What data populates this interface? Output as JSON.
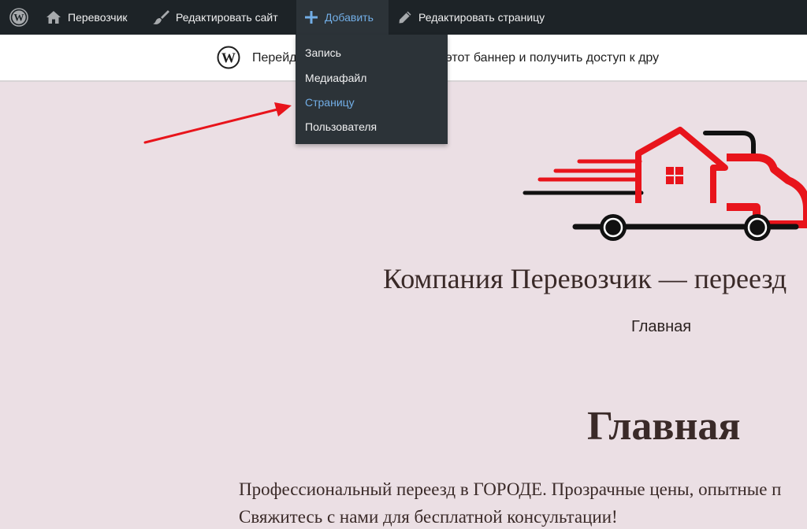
{
  "adminbar": {
    "site_name": "Перевозчик",
    "edit_site_label": "Редактировать сайт",
    "new_label": "Добавить",
    "edit_page_label": "Редактировать страницу"
  },
  "new_menu": {
    "items": [
      "Запись",
      "Медиафайл",
      "Страницу",
      "Пользователя"
    ],
    "active_index": 2
  },
  "banner": {
    "text": "Перейди... й план, чтобы убрать этот баннер и получить доступ к дру"
  },
  "site": {
    "title": "Компания Перевозчик — переезд",
    "nav_home": "Главная"
  },
  "page": {
    "heading": "Главная",
    "paragraph_line1": "Профессиональный переезд в ГОРОДЕ. Прозрачные цены, опытные п",
    "paragraph_line2": "Свяжитесь с нами для бесплатной консультации!"
  },
  "colors": {
    "adminbar_bg": "#1d2327",
    "submenu_bg": "#2c3338",
    "link_accent": "#72aee6",
    "page_bg": "#ebdfe4",
    "logo_red": "#e8141b",
    "annotation_arrow": "#e8141b"
  }
}
